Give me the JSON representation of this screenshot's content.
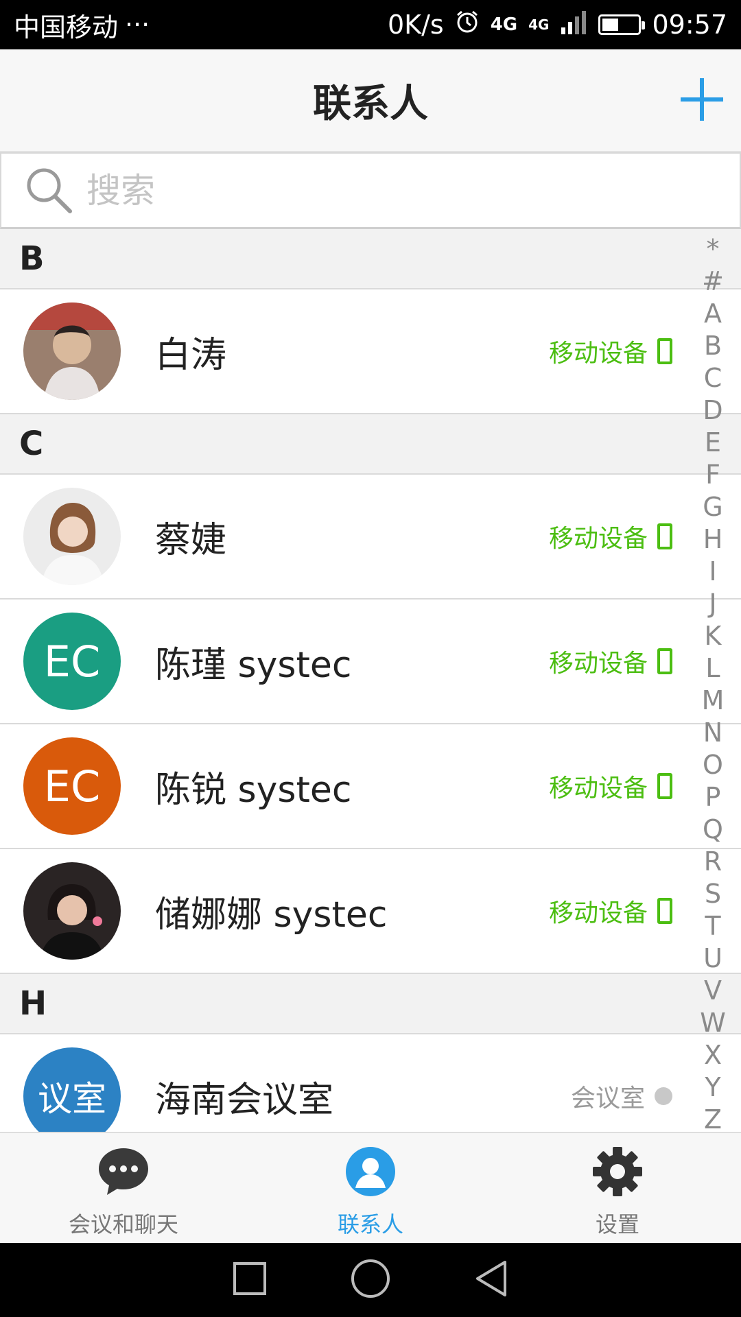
{
  "status_bar": {
    "carrier": "中国移动",
    "dots": "···",
    "net_speed": "0K/s",
    "network1": "4G",
    "network2": "4G",
    "battery_level": 0.45,
    "time": "09:57"
  },
  "header": {
    "title": "联系人",
    "add_icon": "plus-icon"
  },
  "search": {
    "placeholder": "搜索",
    "icon": "search-icon"
  },
  "sections": [
    {
      "letter": "B",
      "contacts": [
        {
          "name": "白涛",
          "tag": "移动设备",
          "tag_type": "mobile",
          "avatar_type": "photo"
        }
      ]
    },
    {
      "letter": "C",
      "contacts": [
        {
          "name": "蔡婕",
          "tag": "移动设备",
          "tag_type": "mobile",
          "avatar_type": "photo"
        },
        {
          "name": "陈瑾 systec",
          "tag": "移动设备",
          "tag_type": "mobile",
          "avatar_text": "EC",
          "avatar_color": "#1a9e82"
        },
        {
          "name": "陈锐 systec",
          "tag": "移动设备",
          "tag_type": "mobile",
          "avatar_text": "EC",
          "avatar_color": "#d95a0b"
        },
        {
          "name": "储娜娜 systec",
          "tag": "移动设备",
          "tag_type": "mobile",
          "avatar_type": "photo"
        }
      ]
    },
    {
      "letter": "H",
      "contacts": [
        {
          "name": "海南会议室",
          "tag": "会议室",
          "tag_type": "room",
          "avatar_text": "议室",
          "avatar_color": "#2c82c4"
        }
      ]
    }
  ],
  "index_letters": [
    "*",
    "#",
    "A",
    "B",
    "C",
    "D",
    "E",
    "F",
    "G",
    "H",
    "I",
    "J",
    "K",
    "L",
    "M",
    "N",
    "O",
    "P",
    "Q",
    "R",
    "S",
    "T",
    "U",
    "V",
    "W",
    "X",
    "Y",
    "Z"
  ],
  "tabs": [
    {
      "label": "会议和聊天",
      "icon": "chat-bubble-icon",
      "active": false
    },
    {
      "label": "联系人",
      "icon": "contact-person-icon",
      "active": true
    },
    {
      "label": "设置",
      "icon": "gear-icon",
      "active": false
    }
  ],
  "colors": {
    "accent": "#2a9de6",
    "mobile_tag": "#4cbe12",
    "room_tag": "#9a9a9a"
  }
}
